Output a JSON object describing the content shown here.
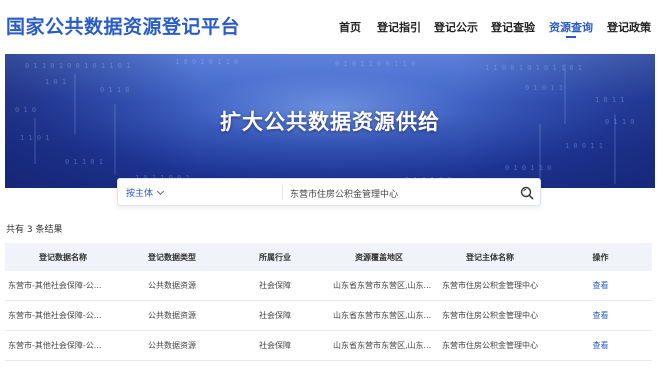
{
  "header": {
    "site_title": "国家公共数据资源登记平台",
    "nav": [
      {
        "label": "首页",
        "active": false
      },
      {
        "label": "登记指引",
        "active": false
      },
      {
        "label": "登记公示",
        "active": false
      },
      {
        "label": "登记查验",
        "active": false
      },
      {
        "label": "资源查询",
        "active": true
      },
      {
        "label": "登记政策",
        "active": false
      }
    ]
  },
  "banner": {
    "title": "扩大公共数据资源供给"
  },
  "search": {
    "filter_label": "按主体",
    "value": "东营市住房公积金管理中心"
  },
  "results": {
    "summary": "共有 3 条结果"
  },
  "table": {
    "headers": [
      "登记数据名称",
      "登记数据类型",
      "所属行业",
      "资源覆盖地区",
      "登记主体名称",
      "操作"
    ],
    "rows": [
      {
        "name": "东营市-其他社会保障-公...",
        "type": "公共数据资源",
        "industry": "社会保障",
        "region": "山东省东营市东营区,山东...",
        "entity": "东营市住房公积金管理中心",
        "action": "查看"
      },
      {
        "name": "东营市-其他社会保障-公...",
        "type": "公共数据资源",
        "industry": "社会保障",
        "region": "山东省东营市东营区,山东...",
        "entity": "东营市住房公积金管理中心",
        "action": "查看"
      },
      {
        "name": "东营市-其他社会保障-公...",
        "type": "公共数据资源",
        "industry": "社会保障",
        "region": "山东省东营市东营区,山东...",
        "entity": "东营市住房公积金管理中心",
        "action": "查看"
      }
    ]
  },
  "colors": {
    "brand": "#2a5cc8",
    "header_row_bg": "#f0f3f9"
  }
}
